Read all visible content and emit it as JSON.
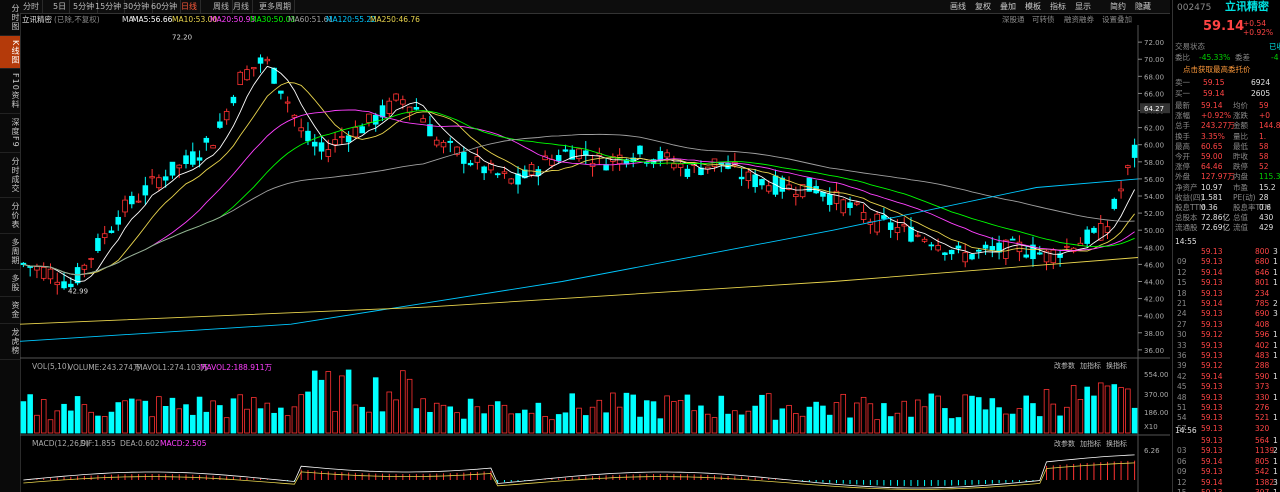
{
  "left_nav": [
    "分时图",
    "K线图",
    "F10资料",
    "深度F9",
    "分时成交",
    "分价表",
    "多周期",
    "多股",
    "资金",
    "龙虎榜"
  ],
  "left_nav_active": 1,
  "periods": [
    "分时",
    "5日",
    "5分钟",
    "15分钟",
    "30分钟",
    "60分钟",
    "日线",
    "周线",
    "月线",
    "更多周期"
  ],
  "period_active": 6,
  "toolbar_right": [
    "画线",
    "复权",
    "叠加",
    "模板",
    "指标",
    "显示",
    "简约",
    "隐藏"
  ],
  "info": {
    "name": "立讯精密",
    "adj": "(已除,不复权)",
    "ma_label": "MA",
    "ma": [
      {
        "text": "MA5:56.66",
        "color": "#ffffff"
      },
      {
        "text": "MA10:53.00",
        "color": "#e8d44d"
      },
      {
        "text": "MA20:50.93",
        "color": "#ff40ff"
      },
      {
        "text": "MA30:50.03",
        "color": "#00ff00"
      },
      {
        "text": "MA60:51.61",
        "color": "#a0a0a0"
      },
      {
        "text": "MA120:55.22",
        "color": "#00c8ff"
      },
      {
        "text": "MA250:46.76",
        "color": "#e8d44d"
      }
    ],
    "links": [
      "深股通",
      "可转债",
      "融资融券",
      "设置叠加"
    ]
  },
  "kline": {
    "price_ticks": [
      "72.00",
      "70.00",
      "68.00",
      "66.00",
      "64.00",
      "62.00",
      "60.00",
      "58.00",
      "56.00",
      "54.00",
      "52.00",
      "50.00",
      "48.00",
      "46.00",
      "44.00",
      "42.00",
      "40.00",
      "38.00",
      "36.00"
    ],
    "current_price_tag": "64.27",
    "high_label": "72.20",
    "low_label": "42.99"
  },
  "volume": {
    "title": "VOL(5,10)",
    "volume_text": "VOLUME:243.274万",
    "mavol1_text": "MAVOL1:274.103万",
    "mavol2_text": "MAVOL2:188.911万",
    "ticks": [
      "554.00",
      "370.00",
      "186.00"
    ],
    "unit": "X10",
    "buttons": [
      "改参数",
      "加指标",
      "换指标"
    ]
  },
  "macd": {
    "title": "MACD(12,26,9)",
    "dif_text": "DIF:1.855",
    "dea_text": "DEA:0.602",
    "macd_text": "MACD:2.505",
    "tick": "6.26",
    "buttons": [
      "改参数",
      "加指标",
      "换指标"
    ]
  },
  "right_panel": {
    "code": "002475",
    "name": "立讯精密",
    "price": "59.14",
    "change": "+0.54",
    "change_pct": "+0.92%",
    "status_label": "交易状态",
    "status_value": "已收",
    "weibi_label": "委比",
    "weibi_value": "-45.33%",
    "weicha_label": "委差",
    "weicha_value": "-4",
    "ad_text": "点击获取最高委托价",
    "sell1": {
      "label": "卖一",
      "price": "59.15",
      "vol": "6924"
    },
    "buy1": {
      "label": "买一",
      "price": "59.14",
      "vol": "2605"
    },
    "quote": [
      [
        "最新",
        "59.14",
        "均价",
        "59"
      ],
      [
        "涨幅",
        "+0.92%",
        "涨跌",
        "+0"
      ],
      [
        "总手",
        "243.27万",
        "金额",
        "144.8"
      ],
      [
        "换手",
        "3.35%",
        "量比",
        "1."
      ],
      [
        "最高",
        "60.65",
        "最低",
        "58"
      ],
      [
        "今开",
        "59.00",
        "昨收",
        "58"
      ],
      [
        "涨停",
        "64.46",
        "跌停",
        "52"
      ],
      [
        "外盘",
        "127.97万",
        "内盘",
        "115.3"
      ],
      [
        "净资产",
        "10.97",
        "市盈",
        "15.2"
      ],
      [
        "收益(四)",
        "1.581",
        "PE(动)",
        "28"
      ],
      [
        "股息TTM",
        "0.36",
        "股息率TTM",
        "0.6"
      ],
      [
        "总股本",
        "72.86亿",
        "总值",
        "430"
      ],
      [
        "流通股",
        "72.69亿",
        "流值",
        "429"
      ]
    ],
    "ticks_time_1": "14:55",
    "ticks_1": [
      [
        "",
        "59.13",
        "800",
        "3"
      ],
      [
        "09",
        "59.13",
        "680",
        "1"
      ],
      [
        "12",
        "59.14",
        "646",
        "1"
      ],
      [
        "15",
        "59.13",
        "801",
        "1"
      ],
      [
        "18",
        "59.13",
        "234",
        ""
      ],
      [
        "21",
        "59.14",
        "785",
        "2"
      ],
      [
        "24",
        "59.13",
        "690",
        "3"
      ],
      [
        "27",
        "59.13",
        "408",
        ""
      ],
      [
        "30",
        "59.12",
        "596",
        "1"
      ],
      [
        "33",
        "59.13",
        "402",
        "1"
      ],
      [
        "36",
        "59.13",
        "483",
        "1"
      ],
      [
        "39",
        "59.12",
        "288",
        ""
      ],
      [
        "42",
        "59.14",
        "590",
        "1"
      ],
      [
        "45",
        "59.13",
        "373",
        ""
      ],
      [
        "48",
        "59.13",
        "330",
        "1"
      ],
      [
        "51",
        "59.13",
        "276",
        ""
      ],
      [
        "54",
        "59.13",
        "521",
        "1"
      ],
      [
        "57",
        "59.13",
        "320",
        ""
      ]
    ],
    "ticks_time_2": "14:56",
    "ticks_2": [
      [
        "",
        "59.13",
        "564",
        "1"
      ],
      [
        "03",
        "59.13",
        "1139",
        "2"
      ],
      [
        "06",
        "59.14",
        "805",
        "1"
      ],
      [
        "09",
        "59.13",
        "542",
        "1"
      ],
      [
        "12",
        "59.14",
        "1382",
        "3"
      ],
      [
        "15",
        "59.13",
        "397",
        "1"
      ]
    ]
  },
  "colors": {
    "up": "#ff3232",
    "down": "#00ffff",
    "bg": "#000000",
    "accent": "#b43a0a"
  }
}
